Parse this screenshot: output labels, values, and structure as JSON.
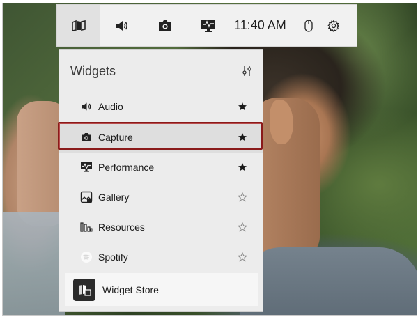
{
  "toolbar": {
    "time": "11:40 AM",
    "buttons": [
      {
        "name": "widget-menu-icon"
      },
      {
        "name": "audio-icon"
      },
      {
        "name": "capture-icon"
      },
      {
        "name": "performance-icon"
      }
    ],
    "trailing": [
      {
        "name": "mouse-icon"
      },
      {
        "name": "settings-icon"
      }
    ]
  },
  "panel": {
    "title": "Widgets",
    "items": [
      {
        "label": "Audio",
        "icon": "speaker-icon",
        "favorite": true
      },
      {
        "label": "Capture",
        "icon": "camera-icon",
        "favorite": true,
        "selected": true
      },
      {
        "label": "Performance",
        "icon": "performance-monitor-icon",
        "favorite": true
      },
      {
        "label": "Gallery",
        "icon": "gallery-icon",
        "favorite": false
      },
      {
        "label": "Resources",
        "icon": "resources-icon",
        "favorite": false
      },
      {
        "label": "Spotify",
        "icon": "spotify-icon",
        "favorite": false
      }
    ],
    "store_label": "Widget Store"
  },
  "colors": {
    "selection_outline": "#8a1a1a",
    "panel_bg": "#ececec",
    "toolbar_bg": "#f1f1f1"
  }
}
